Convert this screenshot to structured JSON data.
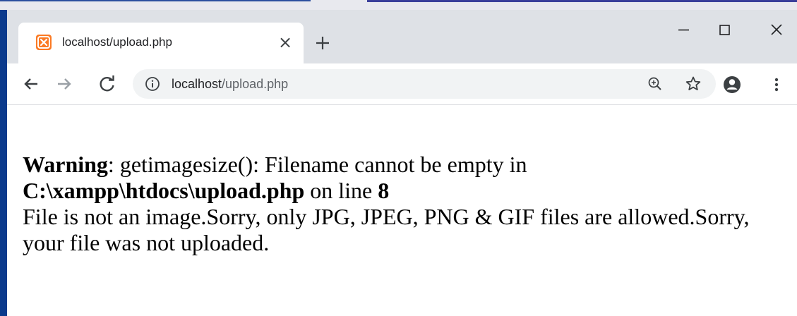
{
  "browser": {
    "tab": {
      "title": "localhost/upload.php",
      "favicon": "xampp-icon",
      "close_glyph": "×"
    },
    "new_tab_glyph": "+",
    "window_controls": [
      "minimize-icon",
      "maximize-icon",
      "close-icon"
    ],
    "address_bar": {
      "host": "localhost",
      "path": "/upload.php",
      "info_icon": "info-icon"
    },
    "toolbar_icons": [
      "back-icon",
      "forward-icon",
      "reload-icon",
      "zoom-icon",
      "star-icon",
      "profile-icon",
      "menu-icon"
    ],
    "colors": {
      "tabstrip": "#dee1e6",
      "omnibox": "#f1f3f4",
      "favicon": "#fb7a24"
    }
  },
  "page": {
    "warning_label": "Warning",
    "warning_text": ": getimagesize(): Filename cannot be empty in",
    "file_path": "C:\\xampp\\htdocs\\upload.php",
    "on_line_text": " on line ",
    "line_number": "8",
    "message": "File is not an image.Sorry, only JPG, JPEG, PNG & GIF files are allowed.Sorry, your file was not uploaded."
  }
}
